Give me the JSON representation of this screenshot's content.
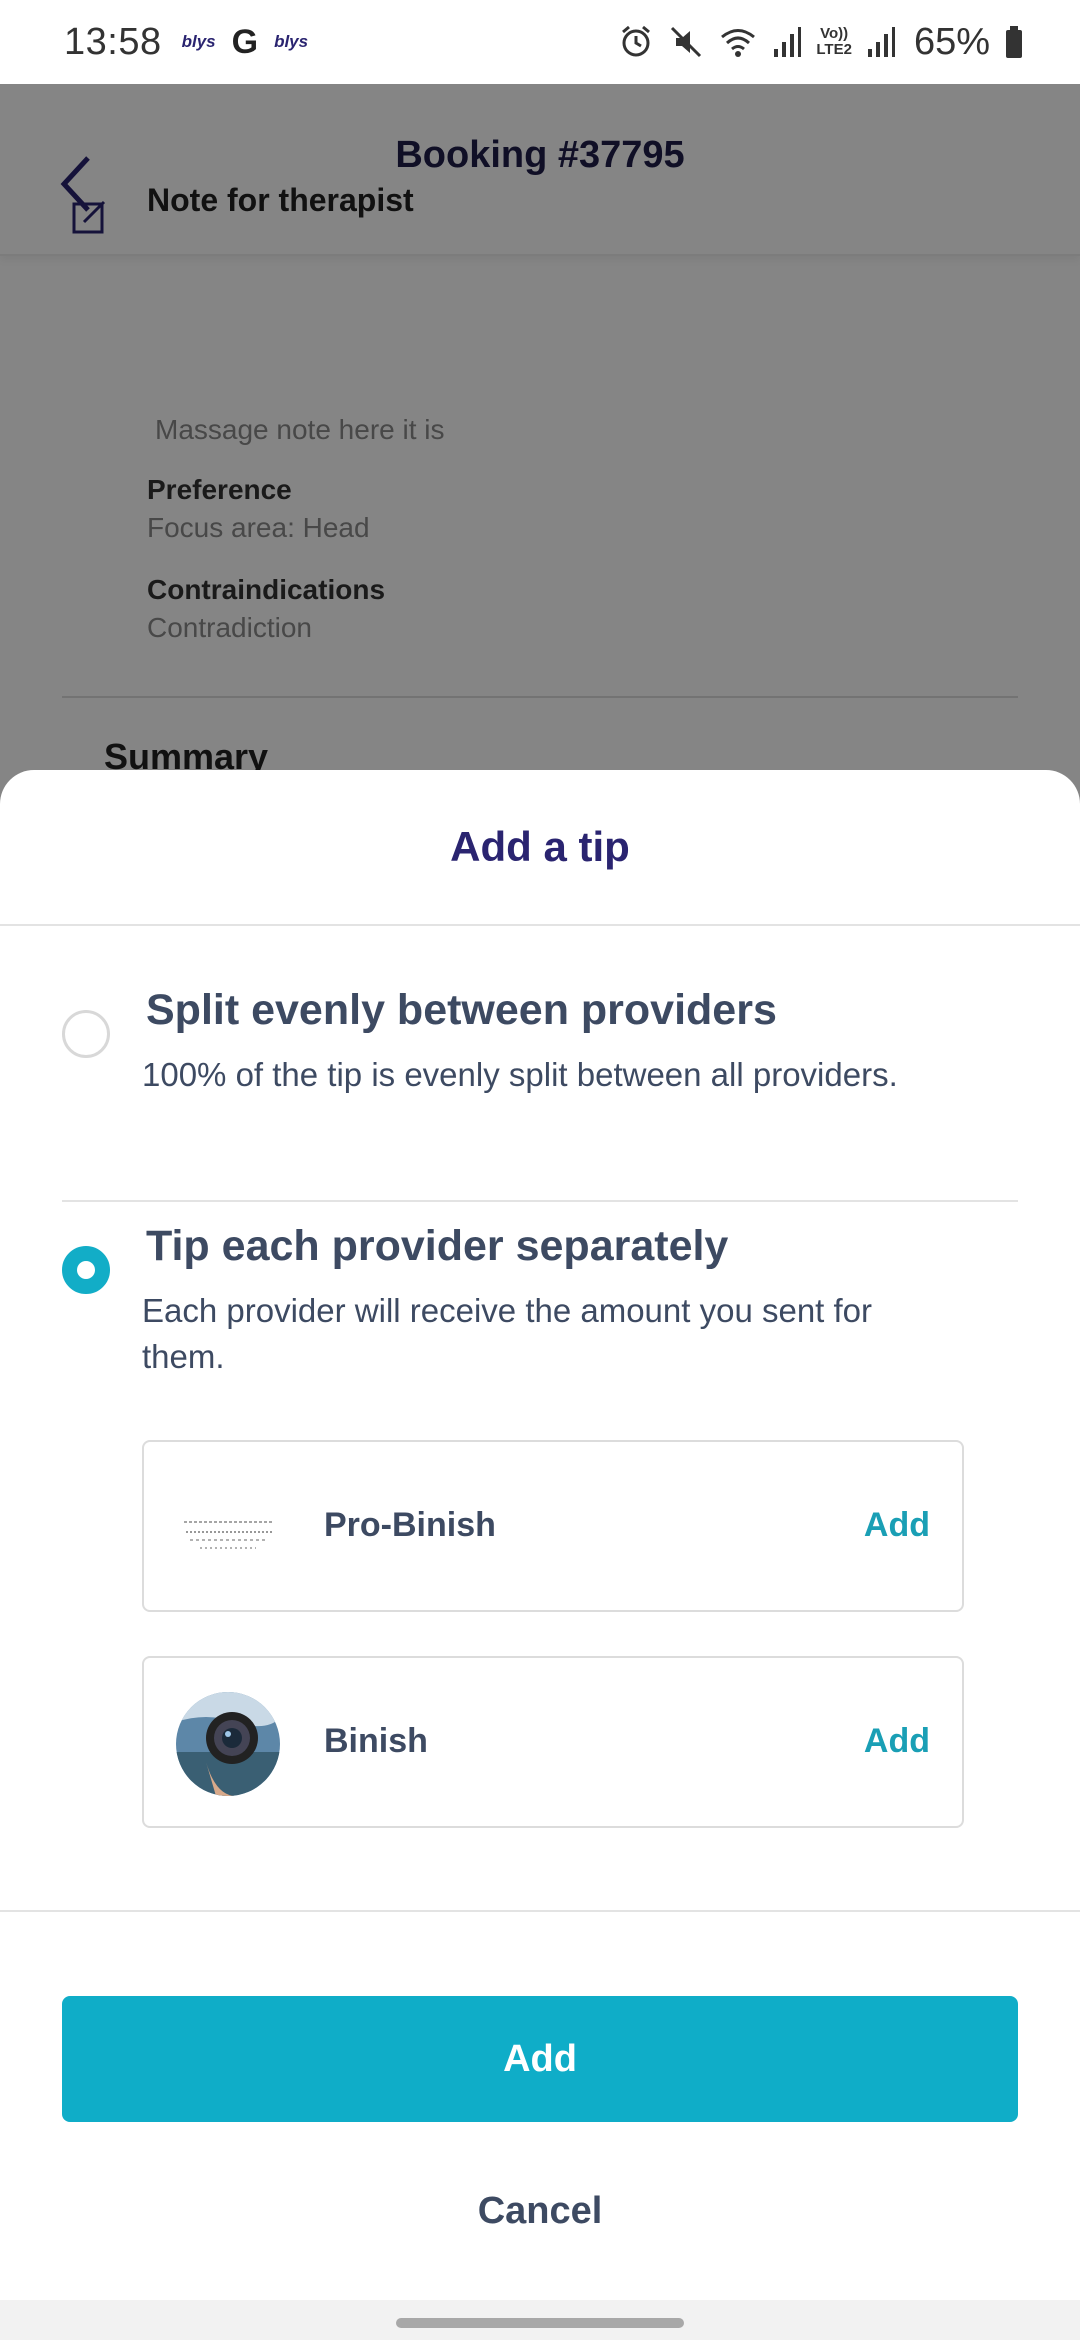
{
  "status_bar": {
    "time": "13:58",
    "notif_icon_1": "blys",
    "notif_icon_2": "G",
    "notif_icon_3": "blys",
    "volte_top": "Vo))",
    "volte_bottom": "LTE2",
    "battery_pct": "65%"
  },
  "header": {
    "title": "Booking #37795"
  },
  "background": {
    "note_heading": "Note for therapist",
    "note_text": "Massage note here it is",
    "preference_label": "Preference",
    "preference_value": "Focus area: Head",
    "contra_label": "Contraindications",
    "contra_value": "Contradiction",
    "summary_heading": "Summary"
  },
  "sheet": {
    "title": "Add a tip",
    "options": [
      {
        "title": "Split evenly between providers",
        "description": "100% of the tip is evenly split between all providers.",
        "selected": false
      },
      {
        "title": "Tip each provider separately",
        "description": "Each provider will receive the amount you sent for them.",
        "selected": true
      }
    ],
    "providers": [
      {
        "name": "Pro-Binish",
        "action": "Add"
      },
      {
        "name": "Binish",
        "action": "Add"
      }
    ],
    "add_button": "Add",
    "cancel_button": "Cancel"
  },
  "colors": {
    "accent": "#0fadc8",
    "title": "#2a2470",
    "text": "#3d4a62"
  }
}
